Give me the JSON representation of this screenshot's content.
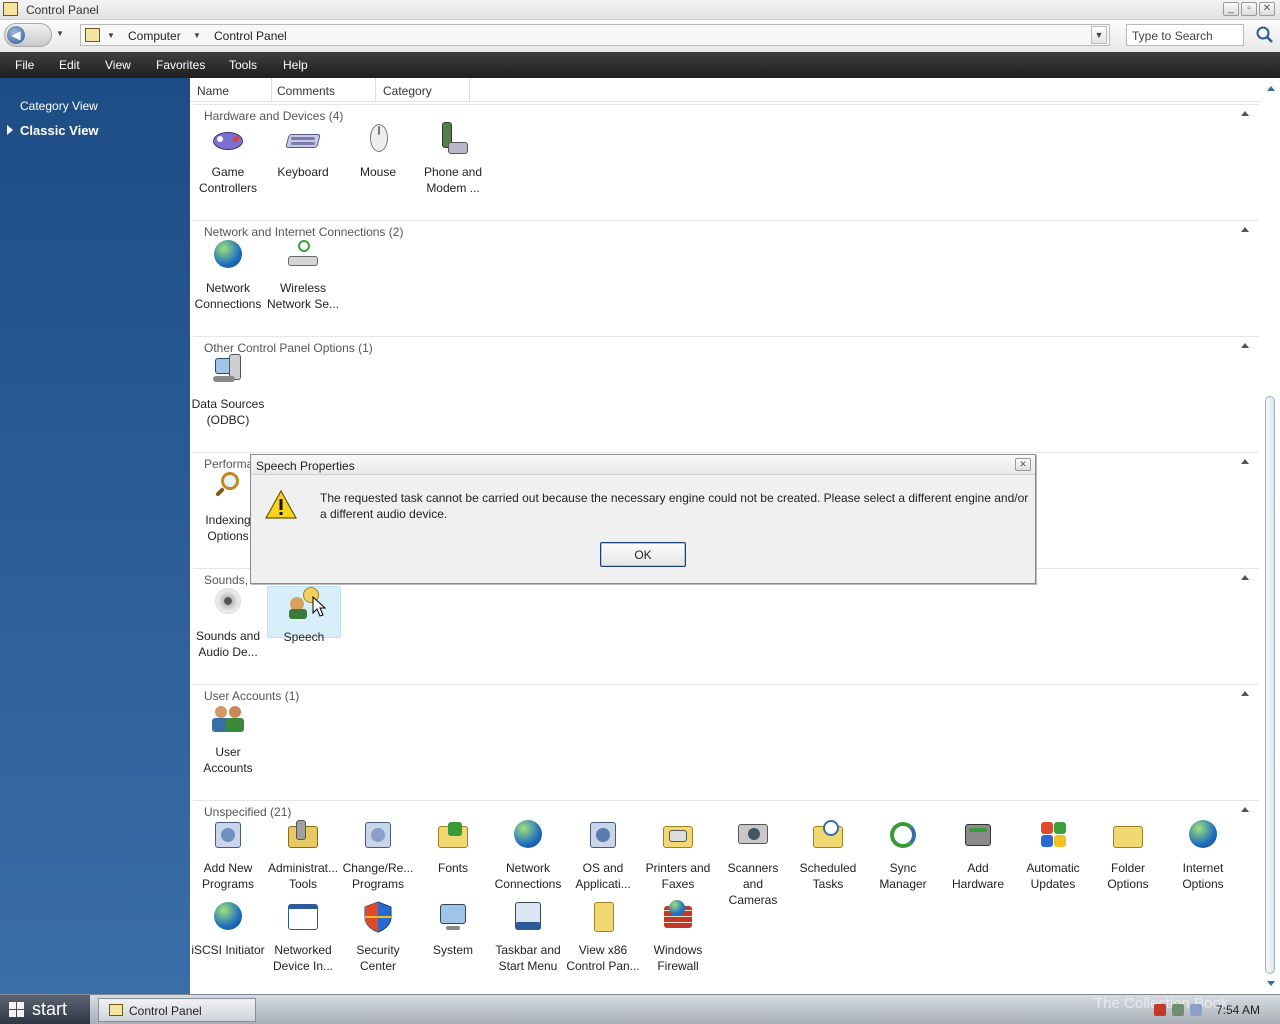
{
  "window": {
    "title": "Control Panel"
  },
  "address": {
    "crumbs": [
      "Computer",
      "Control Panel"
    ],
    "search_placeholder": "Type to Search"
  },
  "menu": [
    "File",
    "Edit",
    "View",
    "Favorites",
    "Tools",
    "Help"
  ],
  "sidebar": {
    "category_view": "Category View",
    "classic_view": "Classic View"
  },
  "columns": [
    "Name",
    "Comments",
    "Category"
  ],
  "groups": {
    "hardware": {
      "title": "Hardware and Devices (4)",
      "items": [
        "Game\nControllers",
        "Keyboard",
        "Mouse",
        "Phone and\nModem ..."
      ]
    },
    "network": {
      "title": "Network and Internet Connections (2)",
      "items": [
        "Network\nConnections",
        "Wireless\nNetwork Se..."
      ]
    },
    "other": {
      "title": "Other Control Panel Options (1)",
      "items": [
        "Data Sources\n(ODBC)"
      ]
    },
    "performance": {
      "title": "Performa",
      "items": [
        "Indexing\nOptions"
      ]
    },
    "sounds": {
      "title": "Sounds,",
      "items": [
        "Sounds and\nAudio De...",
        "Speech"
      ]
    },
    "users": {
      "title": "User Accounts (1)",
      "items": [
        "User\nAccounts"
      ]
    },
    "unspecified": {
      "title": "Unspecified (21)",
      "items": [
        "Add New\nPrograms",
        "Administrat...\nTools",
        "Change/Re...\nPrograms",
        "Fonts",
        "Network\nConnections",
        "OS and\nApplicati...",
        "Printers and\nFaxes",
        "Scanners and\nCameras",
        "Scheduled\nTasks",
        "Sync\nManager",
        "Add\nHardware",
        "Automatic\nUpdates",
        "Folder\nOptions",
        "Internet\nOptions",
        "iSCSI Initiator",
        "Networked\nDevice In...",
        "Security\nCenter",
        "System",
        "Taskbar and\nStart Menu",
        "View x86\nControl Pan...",
        "Windows\nFirewall"
      ]
    }
  },
  "dialog": {
    "title": "Speech Properties",
    "message": "The requested task cannot be carried out because the necessary engine could not be created.  Please select a different engine and/or a different audio device.",
    "ok_label": "OK"
  },
  "taskbar": {
    "start_label": "start",
    "task_label": "Control Panel",
    "watermark": "The Collection Book",
    "clock": "7:54 AM"
  },
  "colors": {
    "sidebar_top": "#1e4c85",
    "sidebar_bottom": "#3a6ea8",
    "menubar": "#2b2b2b",
    "selection": "#d9eefb"
  }
}
